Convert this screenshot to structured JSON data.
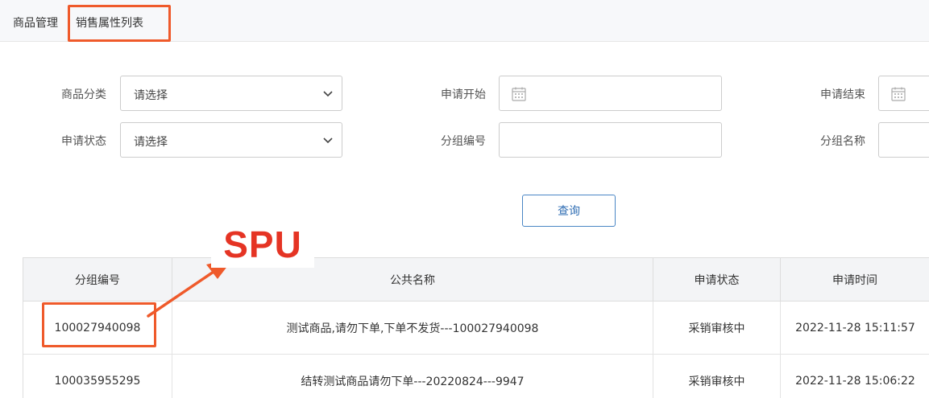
{
  "breadcrumb": {
    "first": "商品管理",
    "second": "销售属性列表"
  },
  "filters": {
    "category": {
      "label": "商品分类",
      "value": "请选择"
    },
    "apply_start": {
      "label": "申请开始"
    },
    "apply_end": {
      "label": "申请结束"
    },
    "apply_status": {
      "label": "申请状态",
      "value": "请选择"
    },
    "group_no": {
      "label": "分组编号"
    },
    "group_name": {
      "label": "分组名称"
    }
  },
  "query_button": "查询",
  "annotation": {
    "text": "SPU",
    "color": "#e53424",
    "box_color": "#ef5a2b"
  },
  "table": {
    "headers": [
      "分组编号",
      "公共名称",
      "申请状态",
      "申请时间"
    ],
    "rows": [
      [
        "100027940098",
        "测试商品,请勿下单,下单不发货---100027940098",
        "采销审核中",
        "2022-11-28 15:11:57"
      ],
      [
        "100035955295",
        "结转测试商品请勿下单---20220824---9947",
        "采销审核中",
        "2022-11-28 15:06:22"
      ]
    ]
  },
  "colors": {
    "accent": "#2f6db3",
    "header_bg": "#f3f4f6",
    "breadcrumb_bg": "#f7f8fa"
  }
}
